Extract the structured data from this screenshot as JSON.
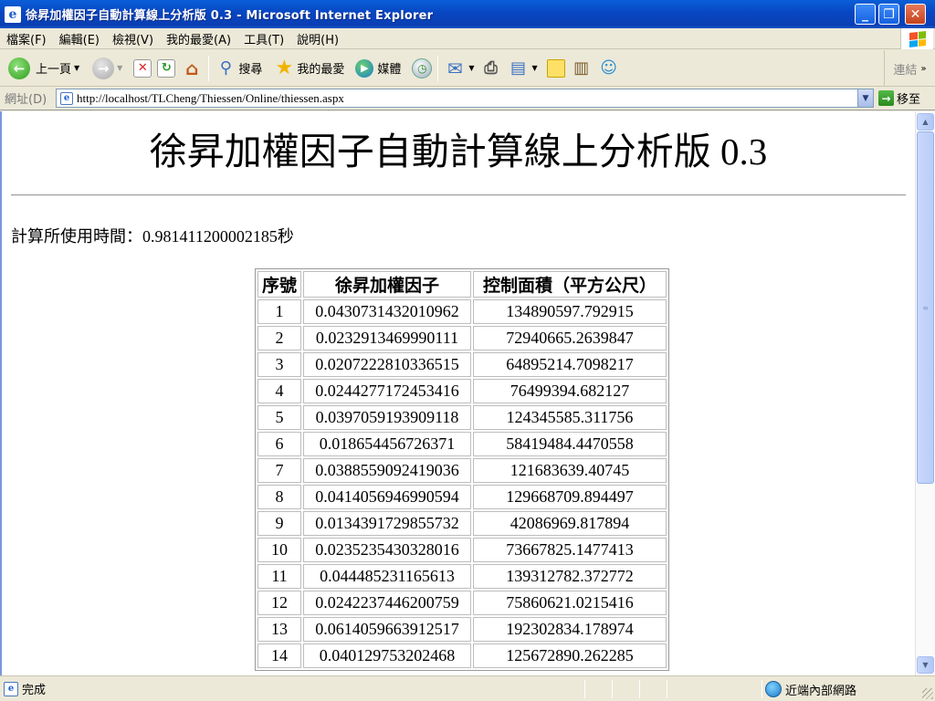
{
  "window": {
    "title": "徐昇加權因子自動計算線上分析版 0.3 - Microsoft Internet Explorer",
    "icon": "ie-page-icon",
    "min_glyph": "_",
    "max_glyph": "❐",
    "close_glyph": "✕"
  },
  "menu": [
    "檔案(F)",
    "編輯(E)",
    "檢視(V)",
    "我的最愛(A)",
    "工具(T)",
    "說明(H)"
  ],
  "toolbar": {
    "back": "上一頁",
    "search": "搜尋",
    "favorites": "我的最愛",
    "media": "媒體",
    "links": "連結"
  },
  "address": {
    "label": "網址(D)",
    "url": "http://localhost/TLCheng/Thiessen/Online/thiessen.aspx",
    "go": "移至"
  },
  "page": {
    "title": "徐昇加權因子自動計算線上分析版 0.3",
    "elapsed": "計算所使用時間：0.981411200002185秒",
    "table_headers": [
      "序號",
      "徐昇加權因子",
      "控制面積（平方公尺）"
    ],
    "rows": [
      [
        "1",
        "0.0430731432010962",
        "134890597.792915"
      ],
      [
        "2",
        "0.0232913469990111",
        "72940665.2639847"
      ],
      [
        "3",
        "0.0207222810336515",
        "64895214.7098217"
      ],
      [
        "4",
        "0.0244277172453416",
        "76499394.682127"
      ],
      [
        "5",
        "0.0397059193909118",
        "124345585.311756"
      ],
      [
        "6",
        "0.018654456726371",
        "58419484.4470558"
      ],
      [
        "7",
        "0.0388559092419036",
        "121683639.40745"
      ],
      [
        "8",
        "0.0414056946990594",
        "129668709.894497"
      ],
      [
        "9",
        "0.0134391729855732",
        "42086969.817894"
      ],
      [
        "10",
        "0.0235235430328016",
        "73667825.1477413"
      ],
      [
        "11",
        "0.044485231165613",
        "139312782.372772"
      ],
      [
        "12",
        "0.0242237446200759",
        "75860621.0215416"
      ],
      [
        "13",
        "0.0614059663912517",
        "192302834.178974"
      ],
      [
        "14",
        "0.040129753202468",
        "125672890.262285"
      ]
    ]
  },
  "status": {
    "text": "完成",
    "zone": "近端內部網路"
  },
  "colors": {
    "titlebar": "#0a46c2",
    "chrome": "#ece9d8",
    "page_bg": "#ffffff"
  }
}
